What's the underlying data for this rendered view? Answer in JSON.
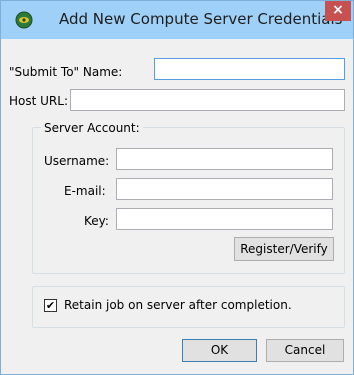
{
  "window": {
    "title": "Add New Compute Server Credentials",
    "close_glyph": "×",
    "app_icon": "app-logo-icon"
  },
  "form": {
    "submit_to_label": "\"Submit To\" Name:",
    "submit_to_value": "",
    "host_url_label": "Host URL:",
    "host_url_value": ""
  },
  "server_account": {
    "legend": "Server Account:",
    "username_label": "Username:",
    "username_value": "",
    "email_label": "E-mail:",
    "email_value": "",
    "key_label": "Key:",
    "key_value": "",
    "register_button": "Register/Verify"
  },
  "options": {
    "retain_label": "Retain job on server after completion.",
    "retain_checked": true,
    "check_glyph": "✔"
  },
  "footer": {
    "ok_label": "OK",
    "cancel_label": "Cancel"
  }
}
